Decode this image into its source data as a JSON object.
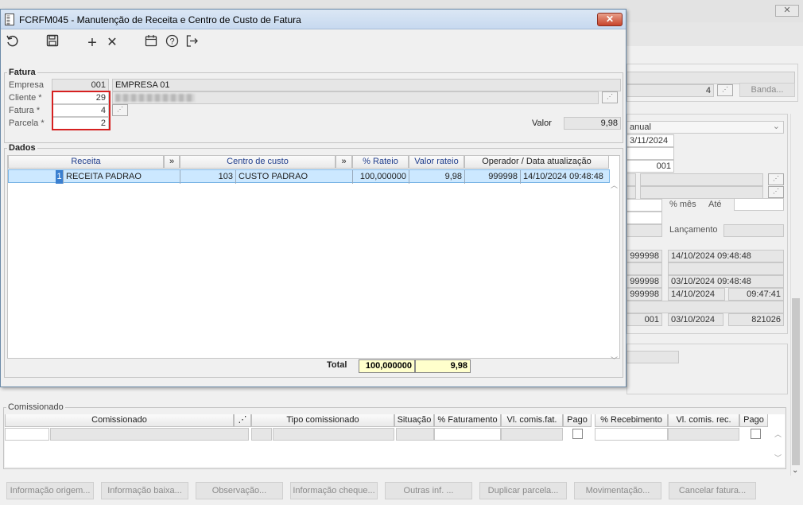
{
  "modal": {
    "title": "FCRFM045 - Manutenção de Receita e Centro de Custo de Fatura",
    "close_label": "✕",
    "fatura": {
      "legend": "Fatura",
      "empresa_label": "Empresa",
      "empresa_code": "001",
      "empresa_name": "EMPRESA 01",
      "cliente_label": "Cliente *",
      "cliente_value": "29",
      "fatura_label": "Fatura *",
      "fatura_value": "4",
      "parcela_label": "Parcela *",
      "parcela_value": "2",
      "valor_label": "Valor",
      "valor_value": "9,98"
    },
    "dados": {
      "legend": "Dados",
      "columns": [
        "Receita",
        "»",
        "Centro de custo",
        "»",
        "% Rateio",
        "Valor rateio",
        "Operador / Data atualização"
      ],
      "rows": [
        {
          "receita_code": "1",
          "receita_name": "RECEITA PADRAO",
          "cc_code": "103",
          "cc_name": "CUSTO PADRAO",
          "rateio": "100,000000",
          "valor": "9,98",
          "operador": "999998",
          "data": "14/10/2024 09:48:48"
        }
      ],
      "total_label": "Total",
      "total_rateio": "100,000000",
      "total_valor": "9,98"
    }
  },
  "background": {
    "close_label": "✕",
    "field_4": "4",
    "banda_button": "Banda...",
    "anual_select": "anual",
    "date_1": "3/11/2024",
    "code_001": "001",
    "pct_mes_label": "% mês",
    "ate_label": "Até",
    "lancamento_label": "Lançamento",
    "log": [
      {
        "op": "999998",
        "date": "14/10/2024 09:48:48",
        "time": ""
      },
      {
        "op": "999998",
        "date": "03/10/2024 09:48:48",
        "time": ""
      },
      {
        "op": "999998",
        "date": "14/10/2024",
        "time": "09:47:41"
      },
      {
        "op": "001",
        "date": "03/10/2024",
        "time": "821026"
      }
    ]
  },
  "comissionado": {
    "legend": "Comissionado",
    "columns": [
      "Comissionado",
      "Tipo comissionado",
      "Situação",
      "% Faturamento",
      "Vl. comis.fat.",
      "Pago",
      "% Recebimento",
      "Vl. comis. rec.",
      "Pago"
    ]
  },
  "bottom_buttons": [
    "Informação origem...",
    "Informação baixa...",
    "Observação...",
    "Informação cheque...",
    "Outras inf. ...",
    "Duplicar parcela...",
    "Movimentação...",
    "Cancelar fatura..."
  ],
  "colors": {
    "selected_row": "#cce8ff",
    "highlight_box": "#d62020",
    "total_bg": "#ffffcc"
  }
}
